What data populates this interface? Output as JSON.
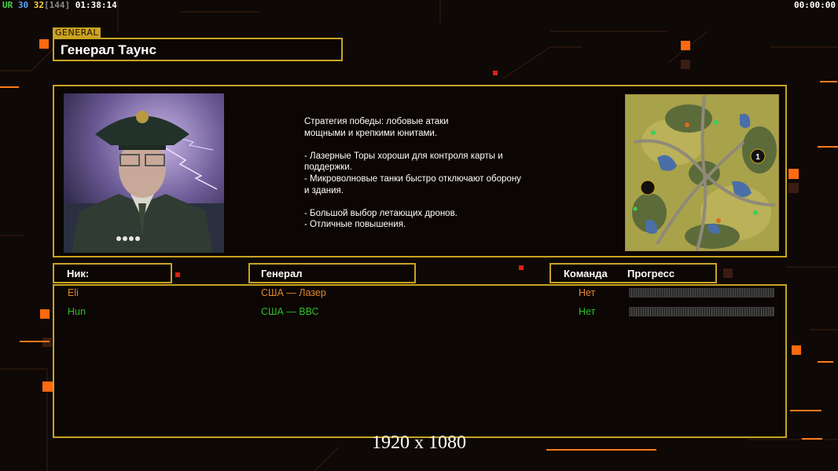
{
  "hud": {
    "left": [
      {
        "text": "UR",
        "color": "#4dd24d"
      },
      {
        "text": " 30",
        "color": "#54a8ff"
      },
      {
        "text": " 32",
        "color": "#ffd23c"
      },
      {
        "text": "[144]",
        "color": "#8a8a8a"
      },
      {
        "text": " 01:38:14",
        "color": "#ffffff"
      }
    ],
    "right_time": "00:00:00"
  },
  "general": {
    "tag": "GENERAL",
    "name": "Генерал Таунс",
    "description": "Стратегия победы: лобовые атаки\nмощными и крепкими юнитами.\n\n- Лазерные Торы хороши для контроля карты и\n поддержки.\n- Микроволновые танки быстро отключают оборону\n и здания.\n\n- Большой выбор летающих дронов.\n- Отличные повышения."
  },
  "minimap": {
    "start_number": "1"
  },
  "table": {
    "headers": {
      "nick": "Ник:",
      "general": "Генерал",
      "team": "Команда",
      "progress": "Прогресс"
    },
    "rows": [
      {
        "nick": "Eli",
        "general": "США — Лазер",
        "team": "Нет",
        "progress": 0,
        "color": "#e0892f"
      },
      {
        "nick": "Hun",
        "general": "США — ВВС",
        "team": "Нет",
        "progress": 0,
        "color": "#2ebd2e"
      }
    ]
  },
  "resolution_label": "1920 x 1080",
  "colors": {
    "frame": "#c9a322",
    "accent": "#ff7a1a"
  }
}
